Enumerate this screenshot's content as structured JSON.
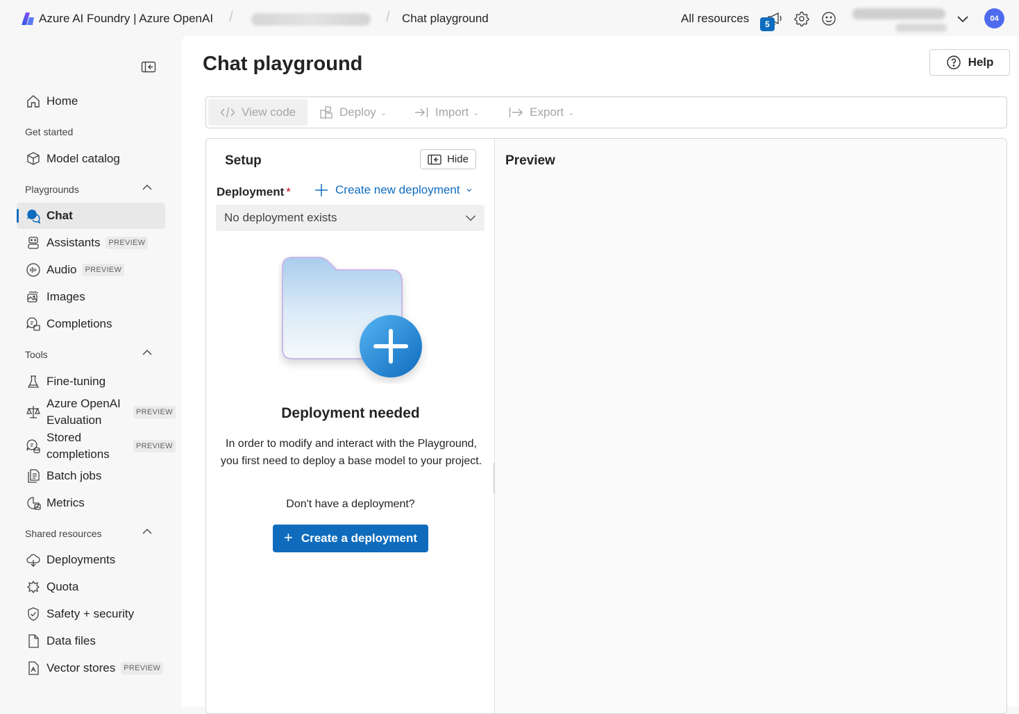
{
  "header": {
    "brand": "Azure AI Foundry | Azure OpenAI",
    "current_page": "Chat playground",
    "all_resources": "All resources",
    "notification_count": "5",
    "avatar_initials": "04"
  },
  "sidebar": {
    "home": "Home",
    "get_started": {
      "title": "Get started",
      "items": [
        "Model catalog"
      ]
    },
    "playgrounds": {
      "title": "Playgrounds",
      "chat": "Chat",
      "assistants": "Assistants",
      "audio": "Audio",
      "images": "Images",
      "completions": "Completions"
    },
    "tools": {
      "title": "Tools",
      "fine_tuning": "Fine-tuning",
      "evaluation": "Azure OpenAI Evaluation",
      "stored_completions": "Stored completions",
      "batch_jobs": "Batch jobs",
      "metrics": "Metrics"
    },
    "shared_resources": {
      "title": "Shared resources",
      "deployments": "Deployments",
      "quota": "Quota",
      "safety": "Safety + security",
      "data_files": "Data files",
      "vector_stores": "Vector stores"
    },
    "preview_tag": "PREVIEW"
  },
  "page": {
    "title": "Chat playground",
    "help": "Help"
  },
  "toolbar": {
    "view_code": "View code",
    "deploy": "Deploy",
    "import": "Import",
    "export": "Export"
  },
  "setup": {
    "title": "Setup",
    "hide": "Hide",
    "deployment_label": "Deployment",
    "required_mark": "*",
    "create_new_deployment": "Create new deployment",
    "deployment_select_value": "No deployment exists",
    "empty_title": "Deployment needed",
    "empty_desc": "In order to modify and interact with the Playground, you first need to deploy a base model to your project.",
    "empty_question": "Don't have a deployment?",
    "create_button": "Create a deployment"
  },
  "preview": {
    "title": "Preview"
  },
  "colors": {
    "accent": "#0f6cbd",
    "avatar": "#4f6bed",
    "required": "#c50f1f"
  }
}
